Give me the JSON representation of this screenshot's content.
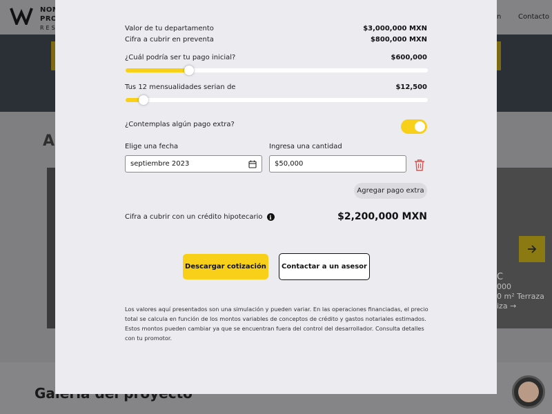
{
  "background": {
    "logo_lines": [
      "NOM",
      "PRO",
      "RES"
    ],
    "nav_partial": "n",
    "nav_contact": "Contacto",
    "section_title_partial": "Ap",
    "card_lines": [
      "C",
      "000",
      "0 m²  Terraza",
      "iza →"
    ],
    "gallery_title": "Galería del proyecto"
  },
  "modal": {
    "value_label": "Valor de tu departamento",
    "value_amount": "$3,000,000 MXN",
    "presale_label": "Cifra a cubrir en preventa",
    "presale_amount": "$800,000 MXN",
    "down_payment_label": "¿Cuál podría ser tu pago inicial?",
    "down_payment_value": "$600,000",
    "down_payment_slider_percent": 21,
    "monthly_label": "Tus 12 mensualidades serian de",
    "monthly_value": "$12,500",
    "monthly_slider_percent": 6,
    "extra_payment_question": "¿Contemplas algún pago extra?",
    "extra_payment_enabled": true,
    "date_label": "Elige una fecha",
    "date_value": "septiembre 2023",
    "amount_label": "Ingresa una cantidad",
    "amount_value": "$50,000",
    "add_extra_button": "Agregar pago extra",
    "credit_label": "Cifra a cubrir con un crédito hipotecario",
    "credit_value": "$2,200,000 MXN",
    "download_button": "Descargar cotización",
    "contact_button": "Contactar a un asesor",
    "disclaimer": "Los valores aquí presentados son una simulación y pueden variar. En las operaciones financiadas, el precio total se calcula en función de los montos variables de conceptos de crédito y gastos notariales estimados. Estos montos pueden cambiar ya que se encuentran fuera del control del desarrollador. Consulta detalles con tu promotor."
  },
  "colors": {
    "accent": "#f8d019",
    "modal_bg": "#ebebf0",
    "trash": "#d9534f"
  },
  "icons": {
    "calendar": "calendar-icon",
    "trash": "trash-icon",
    "info": "info-icon",
    "arrow": "arrow-right-icon"
  }
}
